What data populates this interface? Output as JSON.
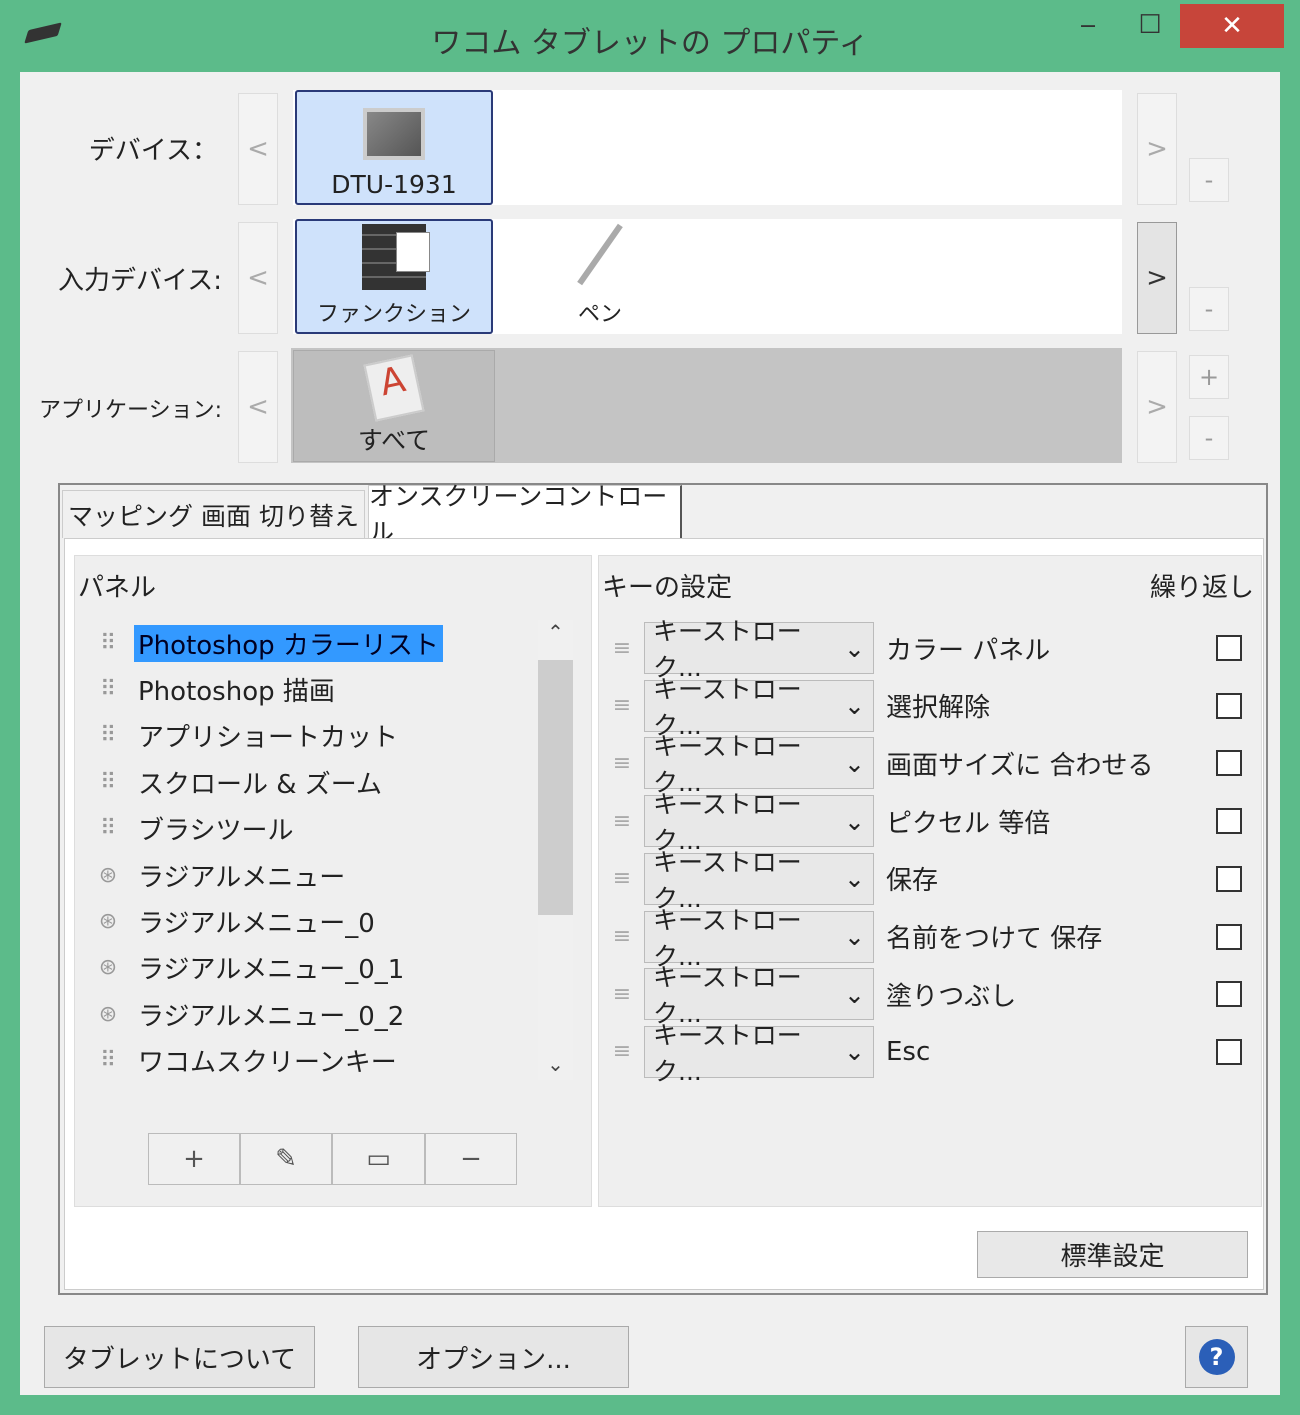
{
  "window": {
    "title": "ワコム タブレットの プロパティ",
    "minimize": "‒",
    "maximize": "☐",
    "close": "✕"
  },
  "rows": {
    "device": {
      "label": "デバイス：",
      "item": "DTU-1931"
    },
    "input": {
      "label": "入力デバイス:",
      "items": [
        "ファンクション",
        "ペン"
      ]
    },
    "app": {
      "label": "アプリケーション:",
      "item": "すべて"
    },
    "prev": "<",
    "next": ">",
    "plus": "+",
    "minus": "-"
  },
  "tabs": [
    "マッピング 画面 切り替え",
    "オンスクリーンコントロール"
  ],
  "panel": {
    "title": "パネル",
    "items": [
      {
        "label": "Photoshop カラーリスト",
        "icon": "grip",
        "selected": true
      },
      {
        "label": "Photoshop 描画",
        "icon": "grip"
      },
      {
        "label": "アプリショートカット",
        "icon": "grip"
      },
      {
        "label": "スクロール & ズーム",
        "icon": "grip"
      },
      {
        "label": "ブラシツール",
        "icon": "grip"
      },
      {
        "label": "ラジアルメニュー",
        "icon": "radial"
      },
      {
        "label": "ラジアルメニュー_0",
        "icon": "radial"
      },
      {
        "label": "ラジアルメニュー_0_1",
        "icon": "radial"
      },
      {
        "label": "ラジアルメニュー_0_2",
        "icon": "radial"
      },
      {
        "label": "ワコムスクリーンキー",
        "icon": "grip"
      }
    ],
    "buttons": [
      "+",
      "✎",
      "▭",
      "−"
    ]
  },
  "keys": {
    "title": "キーの設定",
    "repeat": "繰り返し",
    "rows": [
      {
        "action": "キーストローク...",
        "name": "カラー パネル"
      },
      {
        "action": "キーストローク...",
        "name": "選択解除"
      },
      {
        "action": "キーストローク...",
        "name": "画面サイズに 合わせる"
      },
      {
        "action": "キーストローク...",
        "name": "ピクセル 等倍"
      },
      {
        "action": "キーストローク...",
        "name": "保存"
      },
      {
        "action": "キーストローク...",
        "name": "名前をつけて 保存"
      },
      {
        "action": "キーストローク...",
        "name": "塗りつぶし"
      },
      {
        "action": "キーストローク...",
        "name": "Esc"
      }
    ],
    "default": "標準設定"
  },
  "footer": {
    "about": "タブレットについて",
    "options": "オプション...",
    "help": "?"
  }
}
